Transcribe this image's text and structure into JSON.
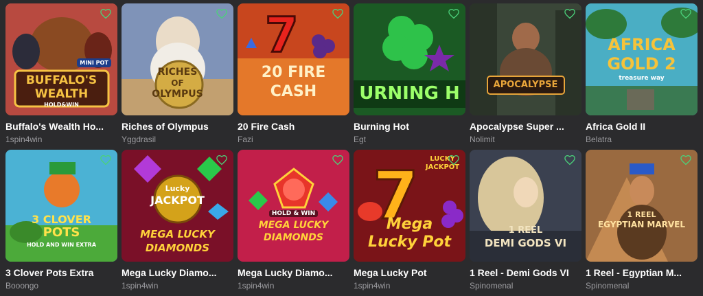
{
  "games": [
    {
      "title": "Buffalo's Wealth Ho...",
      "provider": "1spin4win",
      "logo_lines": [
        "BUFFALO'S",
        "WEALTH",
        "HOLD&WIN"
      ],
      "badge": "MINI POT",
      "bg": "#b8463c",
      "accent": "#f6c343"
    },
    {
      "title": "Riches of Olympus",
      "provider": "Yggdrasil",
      "logo_lines": [
        "RICHES",
        "OF",
        "OLYMPUS"
      ],
      "bg": "#6a7fa8",
      "accent": "#f0d27a"
    },
    {
      "title": "20 Fire Cash",
      "provider": "Fazi",
      "logo_lines": [
        "20 FIRE",
        "CASH"
      ],
      "bg": "#c0391e",
      "accent": "#ffe6a6"
    },
    {
      "title": "Burning Hot",
      "provider": "Egt",
      "logo_lines": [
        "URNING H"
      ],
      "bg": "#1e6a2c",
      "accent": "#9cff6a"
    },
    {
      "title": "Apocalypse Super ...",
      "provider": "Nolimit",
      "logo_lines": [
        "APOCALYPSE"
      ],
      "bg": "#3d4a3a",
      "accent": "#e8a53a"
    },
    {
      "title": "Africa Gold II",
      "provider": "Belatra",
      "logo_lines": [
        "AFRICA",
        "GOLD 2",
        "treasure way"
      ],
      "bg": "#3b9ab0",
      "accent": "#f6c33a"
    },
    {
      "title": "3 Clover Pots Extra",
      "provider": "Booongo",
      "logo_lines": [
        "3 CLOVER",
        "POTS",
        "HOLD AND WIN EXTRA"
      ],
      "bg": "#45a7c8",
      "accent": "#ffe24a"
    },
    {
      "title": "Mega Lucky Diamo...",
      "provider": "1spin4win",
      "logo_lines": [
        "Lucky",
        "JACKPOT",
        "MEGA LUCKY",
        "DIAMONDS"
      ],
      "bg": "#8a1430",
      "accent": "#ffd23a"
    },
    {
      "title": "Mega Lucky Diamo...",
      "provider": "1spin4win",
      "logo_lines": [
        "HOLD & WIN",
        "MEGA LUCKY",
        "DIAMONDS"
      ],
      "bg": "#c21f4a",
      "accent": "#ffd23a"
    },
    {
      "title": "Mega Lucky Pot",
      "provider": "1spin4win",
      "logo_lines": [
        "LUCKY",
        "JACKPOT",
        "Mega",
        "Lucky Pot"
      ],
      "bg": "#7c1418",
      "accent": "#ffd23a"
    },
    {
      "title": "1 Reel - Demi Gods VI",
      "provider": "Spinomenal",
      "logo_lines": [
        "1 REEL",
        "DEMI GODS VI"
      ],
      "bg": "#3b3f4e",
      "accent": "#f2e4c0"
    },
    {
      "title": "1 Reel - Egyptian M...",
      "provider": "Spinomenal",
      "logo_lines": [
        "1 REEL",
        "EGYPTIAN MARVEL"
      ],
      "bg": "#8a5a38",
      "accent": "#ffe1a0"
    }
  ],
  "colors": {
    "background": "#2b2b2d",
    "heart_outline": "#4bd17a",
    "provider_text": "#9c9ca0"
  },
  "icons": {
    "favorite": "heart-outline-icon"
  }
}
